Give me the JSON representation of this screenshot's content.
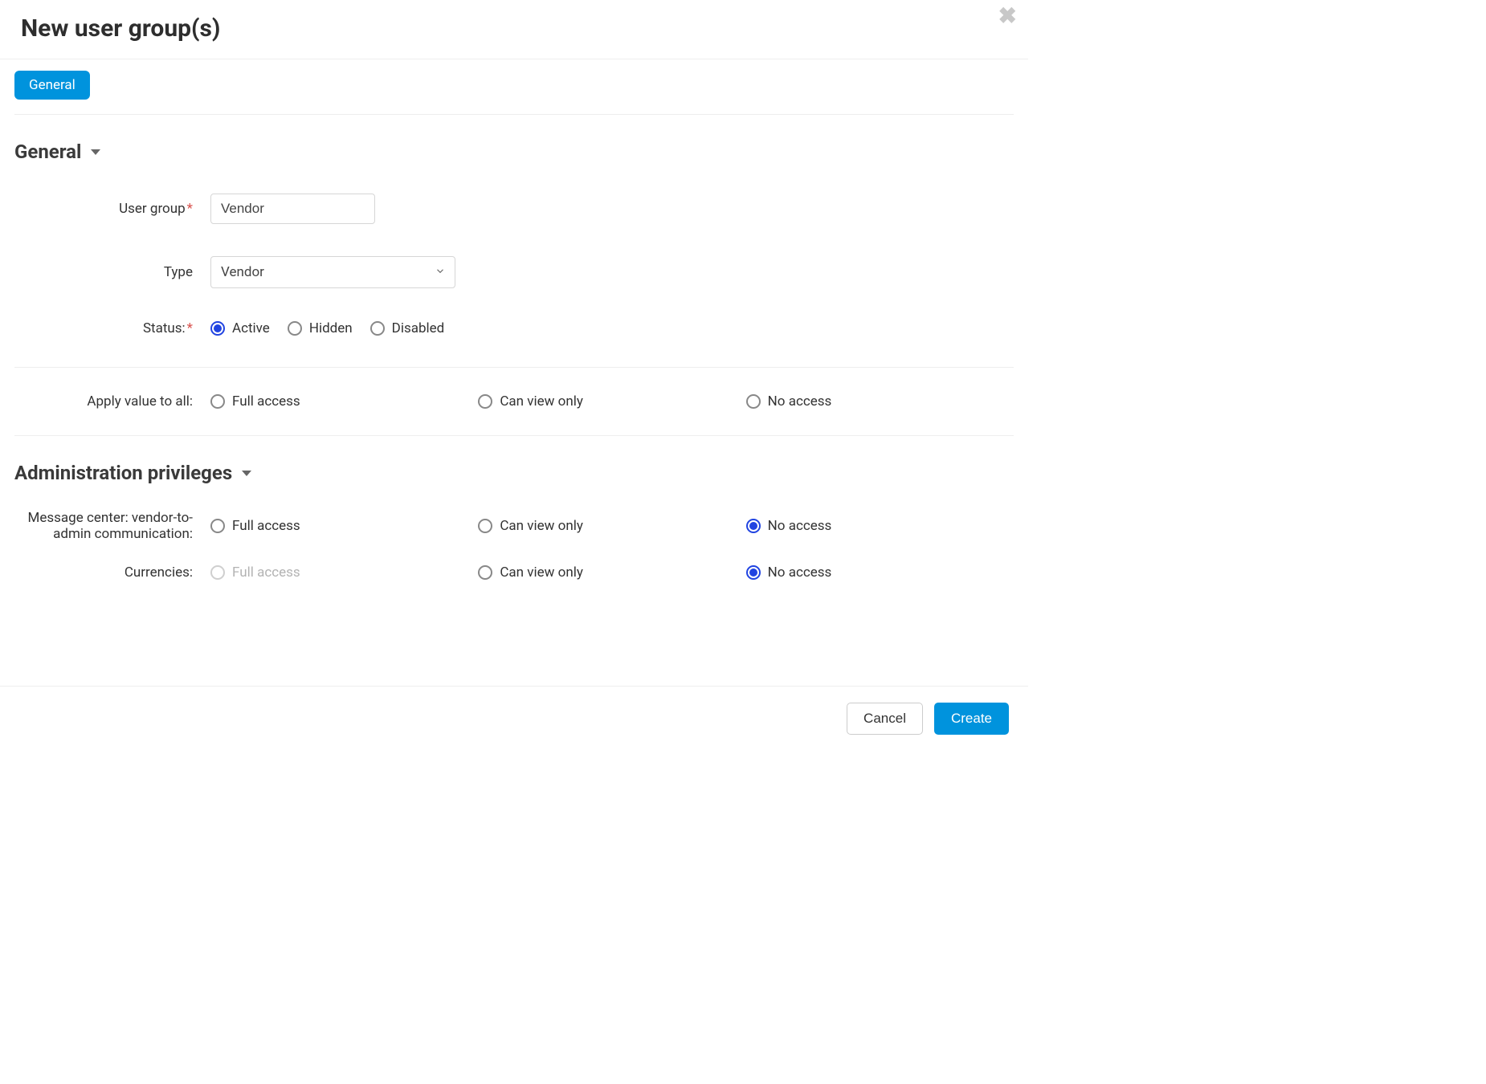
{
  "dialog": {
    "title": "New user group(s)",
    "close_label": "✖"
  },
  "tabs": {
    "general": "General"
  },
  "general": {
    "heading": "General",
    "user_group_label": "User group",
    "user_group_value": "Vendor",
    "type_label": "Type",
    "type_value": "Vendor",
    "status_label": "Status:",
    "status_options": {
      "active": "Active",
      "hidden": "Hidden",
      "disabled": "Disabled"
    },
    "status_selected": "active"
  },
  "apply_all": {
    "label": "Apply value to all:",
    "options": {
      "full": "Full access",
      "view": "Can view only",
      "none": "No access"
    },
    "selected": null
  },
  "privileges": {
    "heading": "Administration privileges",
    "option_labels": {
      "full": "Full access",
      "view": "Can view only",
      "none": "No access"
    },
    "rows": [
      {
        "key": "message_center",
        "label": "Message center: vendor-to-admin communication:",
        "selected": "none",
        "full_disabled": false
      },
      {
        "key": "currencies",
        "label": "Currencies:",
        "selected": "none",
        "full_disabled": true
      }
    ]
  },
  "footer": {
    "cancel": "Cancel",
    "create": "Create"
  }
}
